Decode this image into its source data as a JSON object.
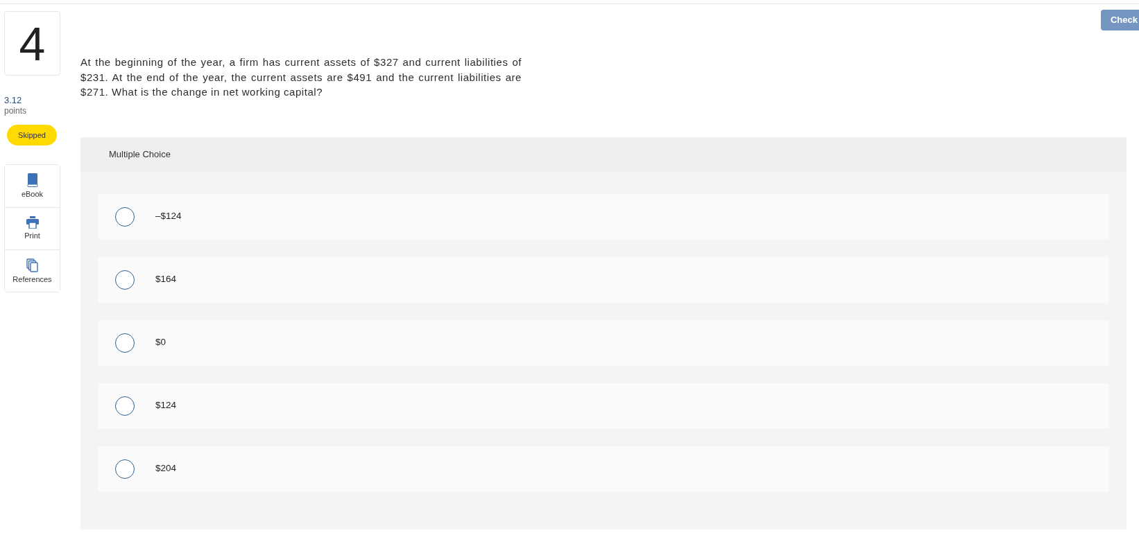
{
  "check_button": {
    "label": "Check",
    "disabled": true
  },
  "question": {
    "number": "4",
    "points_value": "3.12",
    "points_label": "points",
    "status": "Skipped",
    "text": "At the beginning of the year, a firm has current assets of $327 and current liabilities of $231. At the end of the year, the current assets are $491 and the current liabilities are $271. What is the change in net working capital?"
  },
  "tools": [
    {
      "kind": "ebook",
      "label": "eBook"
    },
    {
      "kind": "print",
      "label": "Print"
    },
    {
      "kind": "references",
      "label": "References"
    }
  ],
  "answer": {
    "type_label": "Multiple Choice",
    "options": [
      {
        "label": "–$124",
        "selected": false
      },
      {
        "label": "$164",
        "selected": false
      },
      {
        "label": "$0",
        "selected": false
      },
      {
        "label": "$124",
        "selected": false
      },
      {
        "label": "$204",
        "selected": false
      }
    ]
  }
}
